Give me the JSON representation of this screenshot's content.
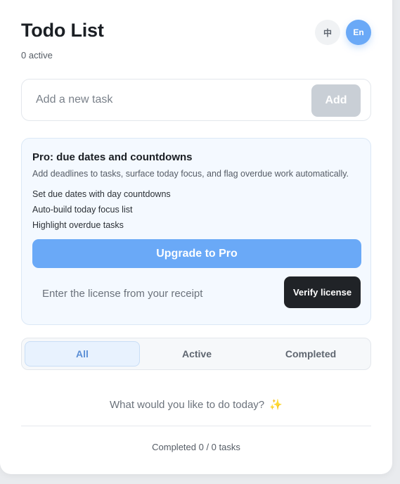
{
  "header": {
    "title": "Todo List",
    "active_count": "0 active",
    "lang_zh": "中",
    "lang_en": "En"
  },
  "add_task": {
    "placeholder": "Add a new task",
    "button_label": "Add"
  },
  "pro": {
    "title": "Pro: due dates and countdowns",
    "description": "Add deadlines to tasks, surface today focus, and flag overdue work automatically.",
    "features": [
      "Set due dates with day countdowns",
      "Auto-build today focus list",
      "Highlight overdue tasks"
    ],
    "upgrade_label": "Upgrade to Pro",
    "license_placeholder": "Enter the license from your receipt",
    "verify_label": "Verify license"
  },
  "filters": {
    "items": [
      "All",
      "Active",
      "Completed"
    ],
    "selected": "All"
  },
  "empty_state": {
    "message": "What would you like to do today?",
    "icon": "sparkle-icon"
  },
  "footer": {
    "summary": "Completed 0 / 0 tasks"
  },
  "colors": {
    "accent": "#6aa9f7",
    "dark_button": "#202327",
    "disabled_button": "#c9cfd6"
  }
}
